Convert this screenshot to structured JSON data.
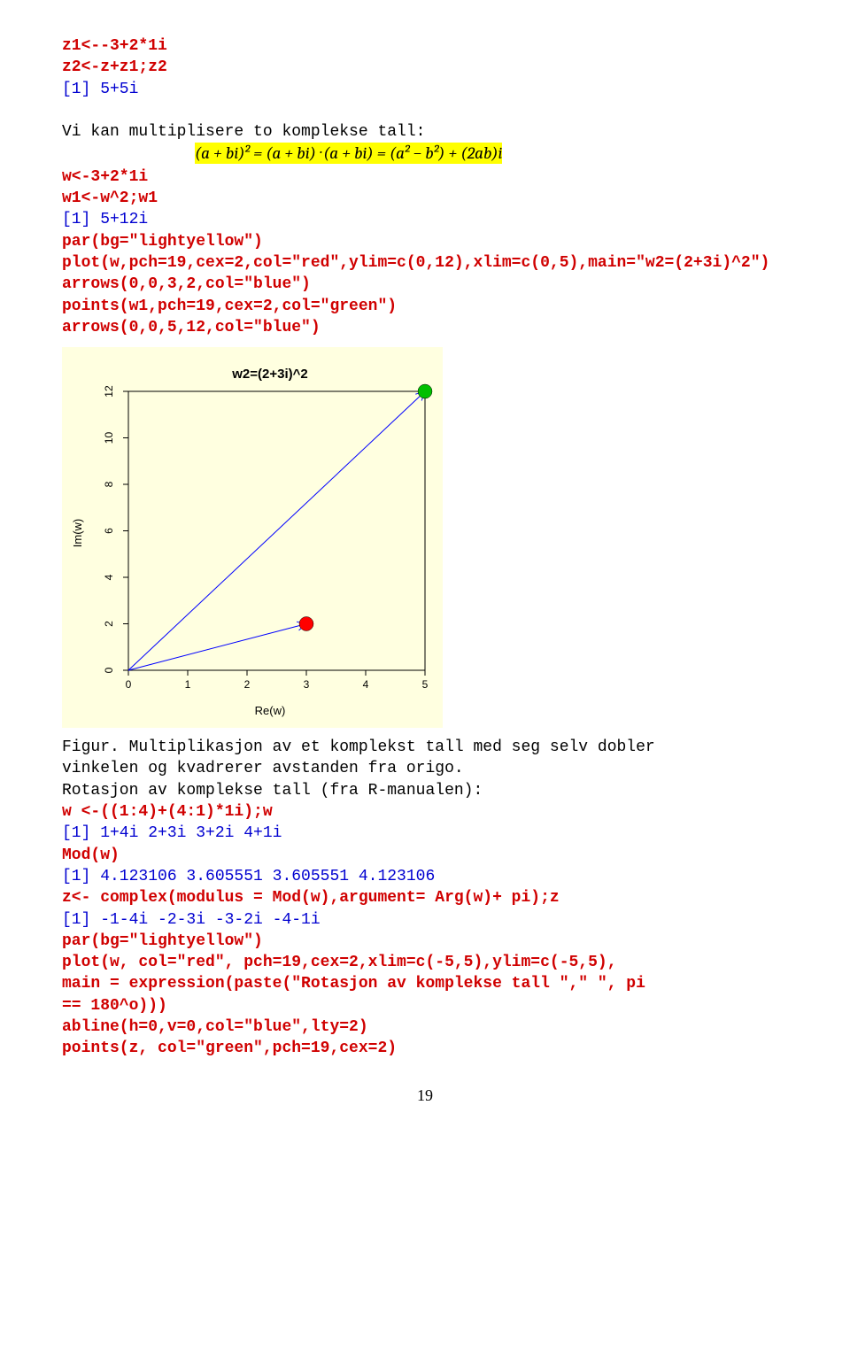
{
  "block1": {
    "l1": "z1<--3+2*1i",
    "l2": "z2<-z+z1;z2",
    "out1": "[1] 5+5i"
  },
  "text1": "Vi kan multiplisere to komplekse tall:",
  "math1": "(a + bi)² = (a + bi) · (a + bi) = (a² − b²) + (2ab)i",
  "block2": {
    "l1": "w<-3+2*1i",
    "l2": "w1<-w^2;w1",
    "out1": "[1] 5+12i",
    "l3": "par(bg=\"lightyellow\")",
    "l4": "plot(w,pch=19,cex=2,col=\"red\",ylim=c(0,12),xlim=c(0,5),main=\"w2=(2+3i)^2\")",
    "l5": "arrows(0,0,3,2,col=\"blue\")",
    "l6": "points(w1,pch=19,cex=2,col=\"green\")",
    "l7": "arrows(0,0,5,12,col=\"blue\")"
  },
  "chart_data": {
    "type": "scatter",
    "title": "w2=(2+3i)^2",
    "xlabel": "Re(w)",
    "ylabel": "Im(w)",
    "xlim": [
      0,
      5
    ],
    "ylim": [
      0,
      12
    ],
    "x_ticks": [
      0,
      1,
      2,
      3,
      4,
      5
    ],
    "y_ticks": [
      0,
      2,
      4,
      6,
      8,
      10,
      12
    ],
    "points": [
      {
        "x": 3,
        "y": 2,
        "color": "red"
      },
      {
        "x": 5,
        "y": 12,
        "color": "green"
      }
    ],
    "arrows": [
      {
        "x0": 0,
        "y0": 0,
        "x1": 3,
        "y1": 2,
        "color": "blue"
      },
      {
        "x0": 0,
        "y0": 0,
        "x1": 5,
        "y1": 12,
        "color": "blue"
      }
    ]
  },
  "text2a": "Figur. Multiplikasjon av et komplekst tall med seg selv dobler",
  "text2b": "vinkelen og kvadrerer avstanden fra origo.",
  "text3": "Rotasjon av komplekse tall (fra R-manualen):",
  "block3": {
    "l1": "w <-((1:4)+(4:1)*1i);w",
    "out1": "[1] 1+4i 2+3i 3+2i 4+1i",
    "l2": "Mod(w)",
    "out2": "[1] 4.123106 3.605551 3.605551 4.123106",
    "l3": "z<- complex(modulus = Mod(w),argument= Arg(w)+ pi);z",
    "out3": "[1] -1-4i -2-3i -3-2i -4-1i",
    "l4": "par(bg=\"lightyellow\")",
    "l5": "plot(w, col=\"red\", pch=19,cex=2,xlim=c(-5,5),ylim=c(-5,5),",
    "l6": "main = expression(paste(\"Rotasjon av komplekse tall \",\" \", pi",
    "l7": "== 180^o)))",
    "l8": "abline(h=0,v=0,col=\"blue\",lty=2)",
    "l9": "points(z, col=\"green\",pch=19,cex=2)"
  },
  "page_number": "19"
}
